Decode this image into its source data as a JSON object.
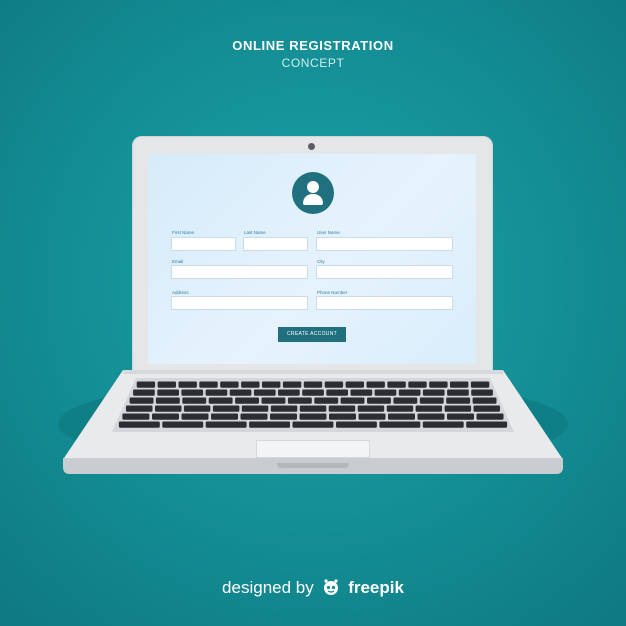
{
  "header": {
    "title": "ONLINE REGISTRATION",
    "subtitle": "CONCEPT"
  },
  "form": {
    "avatar_icon": "user-icon",
    "fields": [
      {
        "id": "first-name",
        "label": "First Name",
        "value": ""
      },
      {
        "id": "last-name",
        "label": "Last Name",
        "value": ""
      },
      {
        "id": "user-name",
        "label": "User Name",
        "value": ""
      },
      {
        "id": "email",
        "label": "Email",
        "value": ""
      },
      {
        "id": "city",
        "label": "City",
        "value": ""
      },
      {
        "id": "address",
        "label": "Address",
        "value": ""
      },
      {
        "id": "phone-number",
        "label": "Phone Number",
        "value": ""
      }
    ],
    "submit_label": "CREATE ACCOUNT"
  },
  "footer": {
    "prefix": "designed by",
    "brand": "freepik",
    "brand_icon": "freepik-logo-icon"
  },
  "colors": {
    "background": "#138d94",
    "accent": "#21707f",
    "screen": "#dcedfa",
    "laptop_body": "#e4e6e8",
    "keys": "#2b2d31"
  }
}
